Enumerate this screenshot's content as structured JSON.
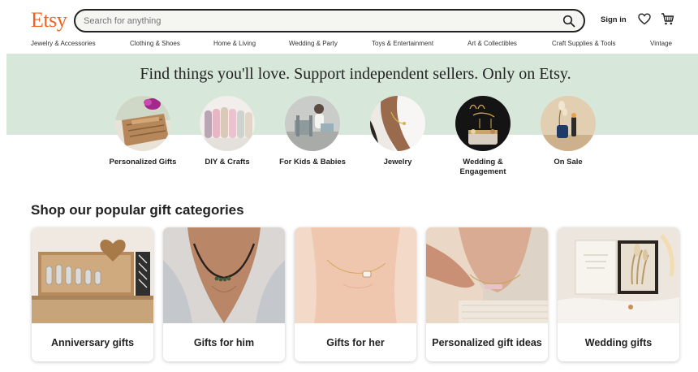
{
  "header": {
    "logo": "Etsy",
    "search_placeholder": "Search for anything",
    "sign_in": "Sign in"
  },
  "nav": {
    "categories": [
      "Jewelry & Accessories",
      "Clothing & Shoes",
      "Home & Living",
      "Wedding & Party",
      "Toys & Entertainment",
      "Art & Collectibles",
      "Craft Supplies & Tools",
      "Vintage"
    ]
  },
  "hero": {
    "title": "Find things you'll love. Support independent sellers. Only on Etsy.",
    "circles": [
      {
        "label": "Personalized Gifts"
      },
      {
        "label": "DIY & Crafts"
      },
      {
        "label": "For Kids & Babies"
      },
      {
        "label": "Jewelry"
      },
      {
        "label": "Wedding & Engagement"
      },
      {
        "label": "On Sale"
      }
    ]
  },
  "gifts": {
    "title": "Shop our popular gift categories",
    "cards": [
      {
        "label": "Anniversary gifts"
      },
      {
        "label": "Gifts for him"
      },
      {
        "label": "Gifts for her"
      },
      {
        "label": "Personalized gift ideas"
      },
      {
        "label": "Wedding gifts"
      }
    ]
  },
  "colors": {
    "brand": "#F1641E",
    "hero_background": "#d7e7da"
  },
  "icons": [
    "search-icon",
    "heart-icon",
    "cart-icon"
  ]
}
